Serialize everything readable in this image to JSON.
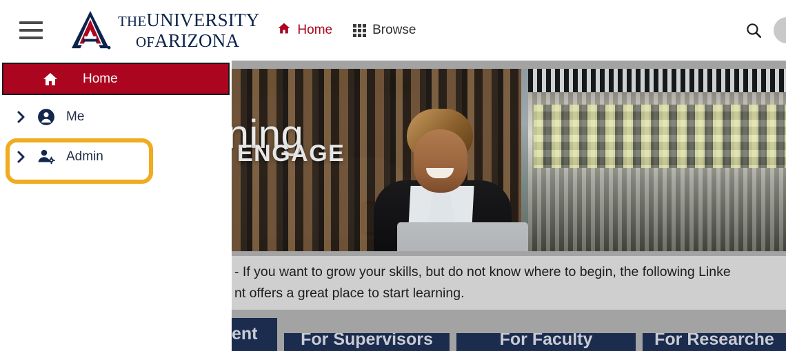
{
  "header": {
    "menu_icon": "hamburger-menu-icon",
    "logo": {
      "line1_small": "THE",
      "line1": "UNIVERSITY",
      "line2_small": "OF",
      "line2": "ARIZONA",
      "alt": "university-of-arizona-logo"
    },
    "nav": [
      {
        "label": "Home",
        "icon": "home-icon",
        "active": true
      },
      {
        "label": "Browse",
        "icon": "grid-apps-icon",
        "active": false
      }
    ],
    "search_icon": "search-icon",
    "avatar": "user-avatar"
  },
  "sidebar": {
    "items": [
      {
        "label": "Home",
        "icon": "home-icon",
        "selected": true,
        "expandable": false
      },
      {
        "label": "Me",
        "icon": "person-icon",
        "selected": false,
        "expandable": true
      },
      {
        "label": "Admin",
        "icon": "person-gear-icon",
        "selected": false,
        "expandable": true,
        "highlighted": true
      }
    ]
  },
  "hero": {
    "title": "arning",
    "subtitle": "ENGAGE",
    "image_alt": "smiling-woman-with-laptop-outdoors"
  },
  "intro": {
    "line1": "- If you want to grow your skills, but do not know where to begin, the following Linke",
    "line2": "nt offers a great place to start learning."
  },
  "table": {
    "headers": [
      "ent",
      "For Supervisors",
      "For Faculty",
      "For Researche"
    ]
  },
  "colors": {
    "brand_red": "#ab0520",
    "brand_navy": "#0c234b",
    "highlight_amber": "#f0ab1f",
    "page_gray": "#a3a3a3",
    "table_navy": "#1b2c4f"
  }
}
